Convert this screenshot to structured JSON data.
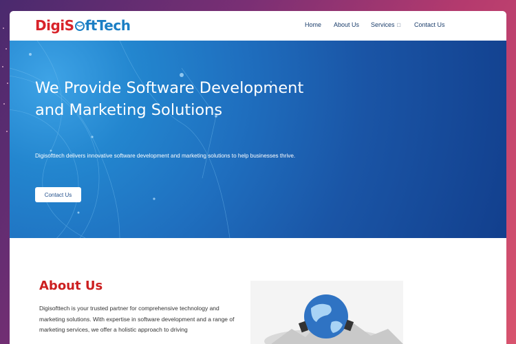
{
  "brand": {
    "logo_part1": "Digi",
    "logo_part2": "S",
    "logo_part3": "ftTech"
  },
  "nav": {
    "items": [
      {
        "label": "Home"
      },
      {
        "label": "About Us"
      },
      {
        "label": "Services",
        "has_dropdown": true
      },
      {
        "label": "Contact Us"
      }
    ]
  },
  "hero": {
    "title": "We Provide Software Development and Marketing Solutions",
    "subtitle": "Digisofttech delivers innovative software development and marketing solutions to help businesses thrive.",
    "button_label": "Contact Us"
  },
  "about": {
    "title": "About Us",
    "text": "Digisofttech is your trusted partner for comprehensive technology and marketing solutions. With expertise in software development and a range of marketing services, we offer a holistic approach to driving"
  },
  "colors": {
    "brand_red": "#cc1f20",
    "brand_blue": "#1c7fc5",
    "nav_text": "#1a3d6b",
    "hero_bg": "#1a55a6"
  },
  "icons": {
    "services_caret": "chevron-down-icon",
    "logo_globe": "globe-icon",
    "about_image": "globe-network-icon"
  }
}
